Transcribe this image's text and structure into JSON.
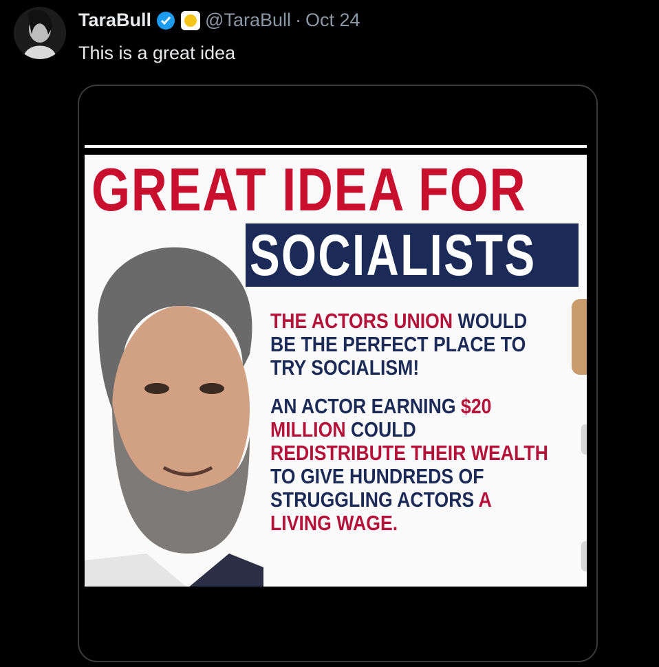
{
  "tweet": {
    "display_name": "TaraBull",
    "handle": "@TaraBull",
    "separator": "·",
    "date": "Oct 24",
    "text": "This is a great idea"
  },
  "meme": {
    "headline": "GREAT IDEA FOR",
    "banner": "SOCIALISTS",
    "para1": {
      "red1": "THE ACTORS UNION",
      "rest1": " WOULD BE THE PERFECT PLACE TO TRY SOCIALISM!"
    },
    "para2": {
      "p1": "AN ACTOR EARNING ",
      "red1": "$20 MILLION",
      "p2": " COULD ",
      "red2": "REDISTRIBUTE THEIR WEALTH",
      "p3": " TO GIVE HUNDREDS OF STRUGGLING ACTORS ",
      "red3": "A LIVING WAGE."
    }
  },
  "colors": {
    "accent_red": "#c8102e",
    "navy": "#1b2a57",
    "verified_blue": "#1d9bf0",
    "muted": "#8b98a5"
  },
  "icons": [
    "avatar",
    "verified-badge-icon",
    "affiliate-badge-icon"
  ]
}
